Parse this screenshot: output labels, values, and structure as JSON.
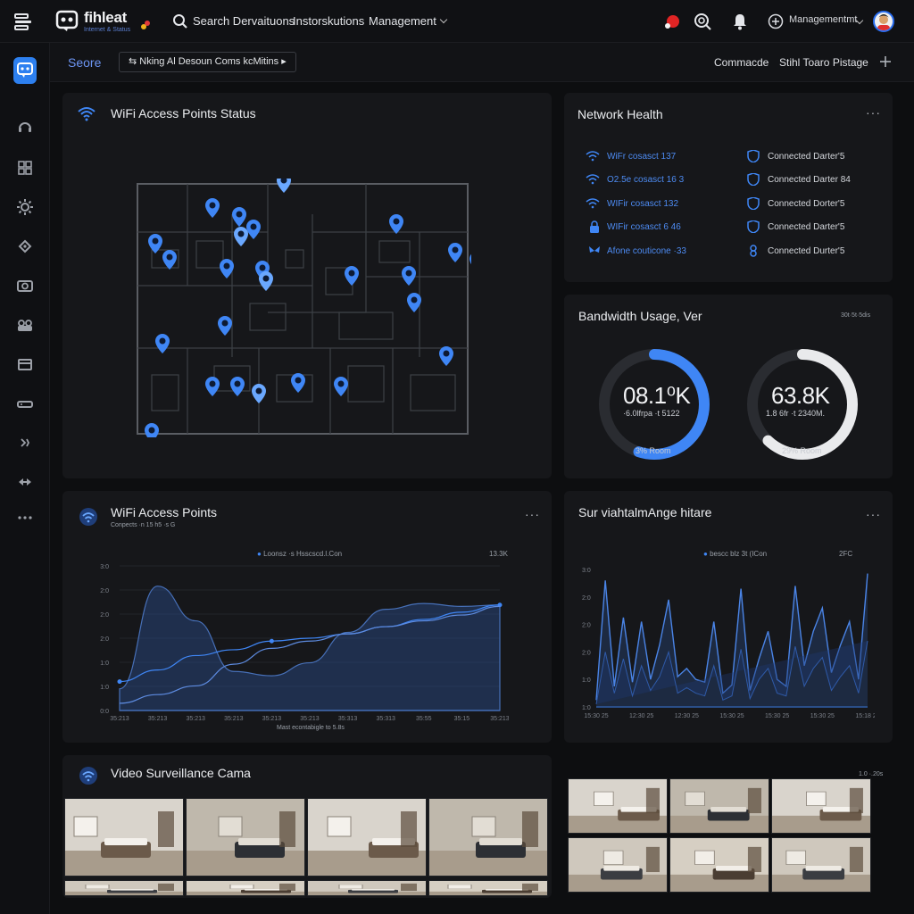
{
  "topbar": {
    "brand": "fihleat",
    "brand_sub": "Internet & Status",
    "search": "Search Dervaituons",
    "nav": [
      "Instorskutions",
      "Management"
    ],
    "user": "Managementmt"
  },
  "subbar": {
    "title": "Seore",
    "breadcrumb": "Nking Al Desoun Coms kcMitins",
    "links": [
      "Commacde",
      "Stihl Toaro Pistage"
    ]
  },
  "wifi_status": {
    "title": "WiFi Access Points Status"
  },
  "network_health": {
    "title": "Network Health",
    "left_items": [
      "WiFr cosasct 137",
      "O2.5e cosasct 16 3",
      "WIFir cosasct 132",
      "WIFir cosasct 6 46",
      "Afone couticone  ·33"
    ],
    "right_items": [
      "Connected Darter'5",
      "Connected Darter 84",
      "Connected Dorter'5",
      "Connected Darter'5",
      "Connected Durter'5"
    ]
  },
  "bandwidth": {
    "title": "Bandwidth Usage, Ver",
    "corner": "30t·5t·5dis",
    "gauges": [
      {
        "value": "08.1⁰K",
        "sub": "·6.0lfrpa ·t 5122",
        "foot": "3% Room",
        "fraction": 0.55,
        "color": "#3f86f5"
      },
      {
        "value": "63.8K",
        "sub": "1.8 6fr ·t 2340M.",
        "foot": "29% Room",
        "fraction": 0.62,
        "color": "#e9eaec"
      }
    ]
  },
  "wifi_points": {
    "title": "WiFi Access Points",
    "subtitle": "Conpects ·n 15 h5 ·s G",
    "legend": "Loonsz ·s Hsscscd.l.Con",
    "legend_right": "13.3K",
    "xlabel": "Mast econtabigle to 5.8s"
  },
  "surveillance_chart": {
    "title": "Sur viahtalmAnge hitare",
    "legend": "bescc blz 3t (ICon",
    "legend_right": "2FC"
  },
  "video": {
    "title": "Video Surveillance Cama",
    "corner": "1.0 ·.20s"
  },
  "chart_data": [
    {
      "type": "area",
      "title": "WiFi Access Points",
      "x": [
        "35:213",
        "35:213",
        "35:213",
        "35:213",
        "35:213",
        "35:213",
        "35:313",
        "35:313",
        "35:55",
        "35:15",
        "35:213"
      ],
      "yticks": [
        "3:0",
        "2:0",
        "2:0",
        "2:0",
        "1:0",
        "1:0",
        "0:0"
      ],
      "series": [
        {
          "values": [
            0.15,
            0.86,
            0.62,
            0.27,
            0.24,
            0.33,
            0.54,
            0.7,
            0.74,
            0.72,
            0.73
          ]
        },
        {
          "values": [
            0.2,
            0.28,
            0.38,
            0.42,
            0.48,
            0.5,
            0.53,
            0.58,
            0.63,
            0.68,
            0.73
          ]
        },
        {
          "values": [
            0.05,
            0.11,
            0.17,
            0.32,
            0.43,
            0.48,
            0.53,
            0.58,
            0.62,
            0.66,
            0.72
          ]
        }
      ]
    },
    {
      "type": "line",
      "title": "Sur viahtalmAnge hitare",
      "x": [
        "15:30 25",
        "12:30 25",
        "12:30 25",
        "15:30 25",
        "15:30 25",
        "15:30 25",
        "15:18 25"
      ],
      "yticks": [
        "3:0",
        "2:0",
        "2:0",
        "2:0",
        "1:0",
        "1:0"
      ],
      "series": [
        {
          "values": [
            0.05,
            0.92,
            0.15,
            0.65,
            0.18,
            0.62,
            0.2,
            0.45,
            0.78,
            0.22,
            0.28,
            0.2,
            0.18,
            0.62,
            0.1,
            0.16,
            0.86,
            0.12,
            0.35,
            0.55,
            0.2,
            0.15,
            0.88,
            0.3,
            0.55,
            0.72,
            0.25,
            0.45,
            0.62,
            0.2,
            0.97
          ]
        },
        {
          "values": [
            0.02,
            0.4,
            0.1,
            0.35,
            0.08,
            0.3,
            0.12,
            0.22,
            0.4,
            0.1,
            0.14,
            0.1,
            0.08,
            0.3,
            0.05,
            0.08,
            0.42,
            0.06,
            0.2,
            0.28,
            0.1,
            0.08,
            0.44,
            0.15,
            0.28,
            0.36,
            0.12,
            0.22,
            0.3,
            0.1,
            0.48
          ]
        }
      ]
    }
  ]
}
